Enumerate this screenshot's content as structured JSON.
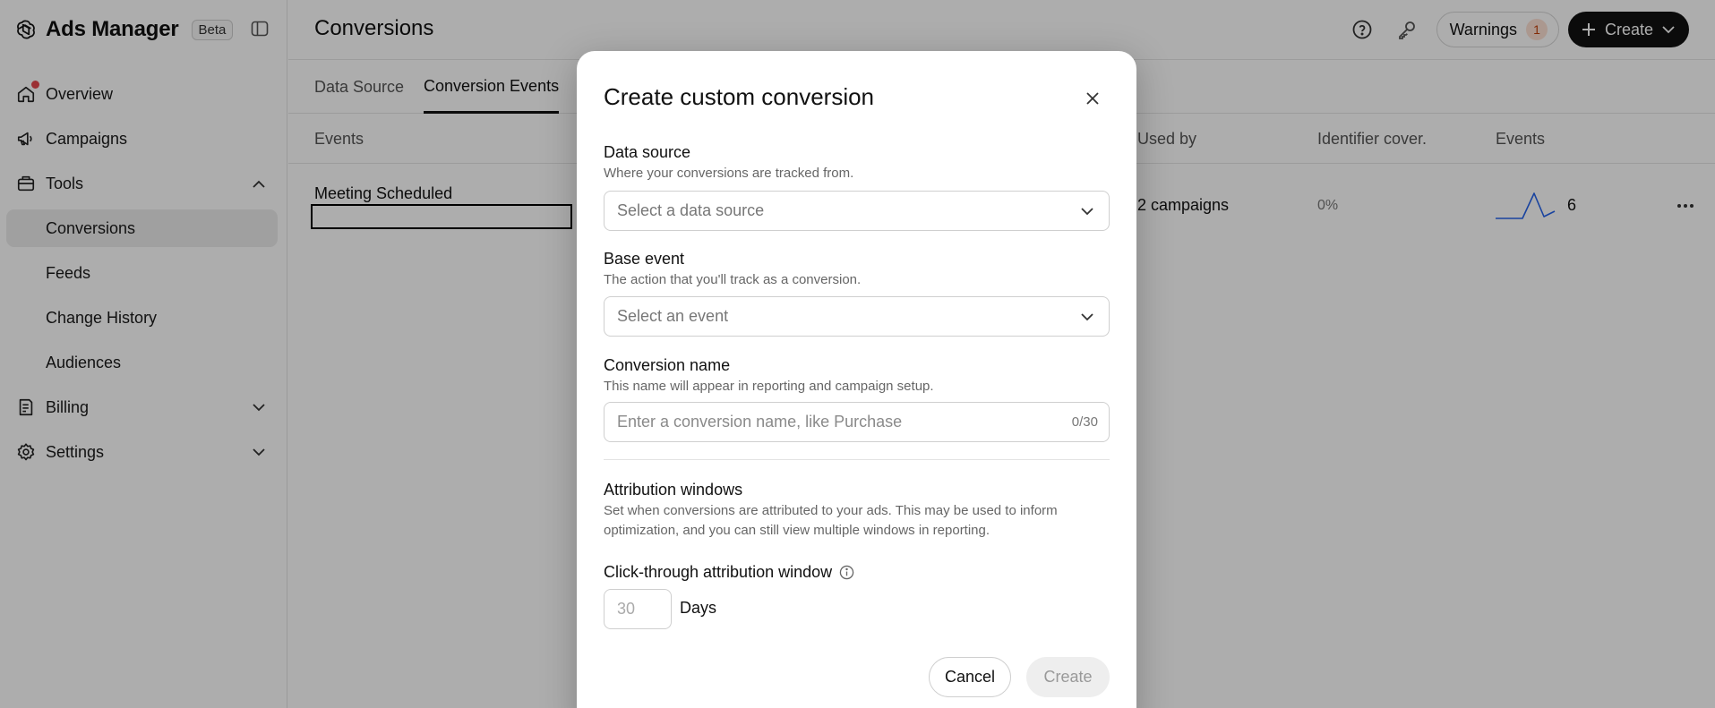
{
  "app": {
    "title": "Ads Manager",
    "badge": "Beta"
  },
  "sidebar": {
    "items": [
      {
        "label": "Overview",
        "icon": "home-icon",
        "has_notification": true
      },
      {
        "label": "Campaigns",
        "icon": "megaphone-icon"
      },
      {
        "label": "Tools",
        "icon": "toolbox-icon",
        "expanded": true
      },
      {
        "label": "Conversions",
        "sub": true,
        "active": true
      },
      {
        "label": "Feeds",
        "sub": true
      },
      {
        "label": "Change History",
        "sub": true
      },
      {
        "label": "Audiences",
        "sub": true
      },
      {
        "label": "Billing",
        "icon": "receipt-icon",
        "expanded": false
      },
      {
        "label": "Settings",
        "icon": "gear-icon",
        "expanded": false
      }
    ]
  },
  "header": {
    "title": "Conversions",
    "warnings_label": "Warnings",
    "warnings_count": "1",
    "create_label": "Create"
  },
  "tabs": [
    {
      "label": "Data Source",
      "active": false
    },
    {
      "label": "Conversion Events",
      "active": true
    }
  ],
  "table": {
    "columns": [
      "Events",
      "Used by",
      "Identifier cover.",
      "Events"
    ],
    "rows": [
      {
        "name": "Meeting Scheduled",
        "used_by": "2 campaigns",
        "coverage": "0%",
        "events": "6"
      }
    ]
  },
  "modal": {
    "title": "Create custom conversion",
    "data_source": {
      "label": "Data source",
      "help": "Where your conversions are tracked from.",
      "placeholder": "Select a data source"
    },
    "base_event": {
      "label": "Base event",
      "help": "The action that you'll track as a conversion.",
      "placeholder": "Select an event"
    },
    "conversion_name": {
      "label": "Conversion name",
      "help": "This name will appear in reporting and campaign setup.",
      "placeholder": "Enter a conversion name, like Purchase",
      "value": "",
      "counter": "0/30"
    },
    "attribution": {
      "label": "Attribution windows",
      "help": "Set when conversions are attributed to your ads. This may be used to inform optimization, and you can still view multiple windows in reporting."
    },
    "click_through": {
      "label": "Click-through attribution window",
      "placeholder": "30",
      "unit": "Days"
    },
    "cancel_label": "Cancel",
    "create_label": "Create"
  },
  "colors": {
    "accent_dark": "#111111",
    "notification_dot": "#e5484d",
    "warning_badge_bg": "#fde0d3",
    "sparkline": "#2563eb"
  }
}
